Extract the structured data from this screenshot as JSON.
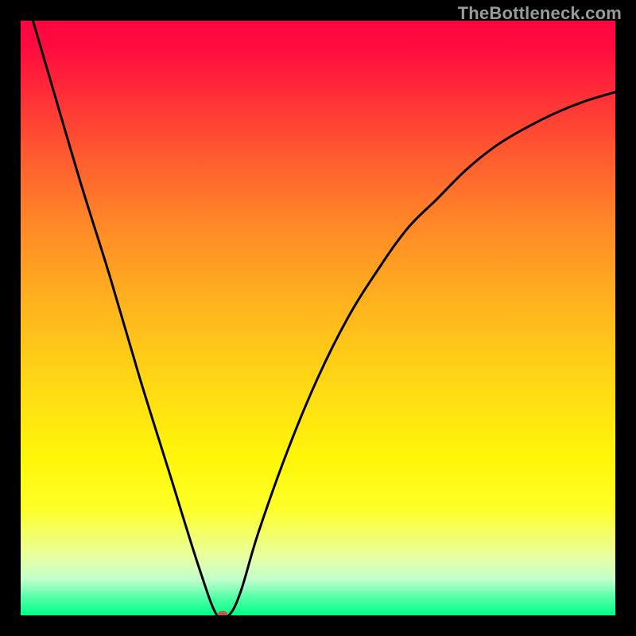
{
  "watermark": "TheBottleneck.com",
  "chart_data": {
    "type": "line",
    "title": "",
    "xlabel": "",
    "ylabel": "",
    "xlim": [
      0,
      100
    ],
    "ylim": [
      0,
      100
    ],
    "grid": false,
    "legend": false,
    "background": "rainbow-gradient",
    "series": [
      {
        "name": "bottleneck-curve",
        "x": [
          0,
          5,
          10,
          15,
          20,
          25,
          30,
          33,
          35,
          37,
          40,
          45,
          50,
          55,
          60,
          65,
          70,
          75,
          80,
          85,
          90,
          95,
          100
        ],
        "y": [
          107,
          90,
          73,
          57,
          40,
          24,
          8,
          0,
          0,
          4,
          14,
          28,
          40,
          50,
          58,
          65,
          70,
          75,
          79,
          82,
          84.5,
          86.5,
          88
        ]
      }
    ],
    "marker": {
      "name": "optimal-point",
      "x": 34,
      "y": 0,
      "color": "#c1534b"
    },
    "colors": {
      "top": "#ff0440",
      "bottom": "#00ff88",
      "curve": "#000000"
    }
  }
}
